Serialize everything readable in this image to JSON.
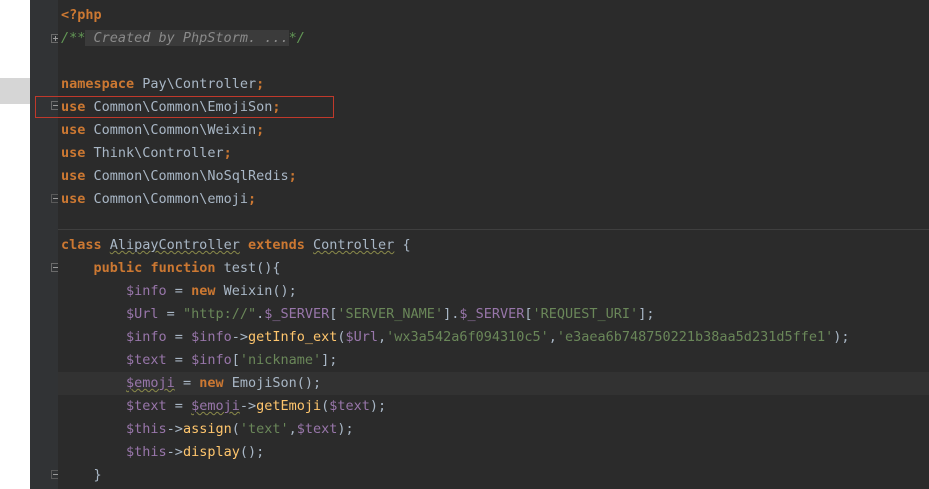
{
  "php_open": "<?php",
  "comment": {
    "open": "/**",
    "inner": " Created by PhpStorm. ...",
    "close": "*/"
  },
  "namespace": {
    "kw": "namespace",
    "name": "Pay\\Controller",
    "semi": ";"
  },
  "uses": [
    {
      "kw": "use",
      "name": "Common\\Common\\EmojiSon",
      "semi": ";"
    },
    {
      "kw": "use",
      "name": "Common\\Common\\Weixin",
      "semi": ";"
    },
    {
      "kw": "use",
      "name": "Think\\Controller",
      "semi": ";"
    },
    {
      "kw": "use",
      "name": "Common\\Common\\NoSqlRedis",
      "semi": ";"
    },
    {
      "kw": "use",
      "name": "Common\\Common\\emoji",
      "semi": ";"
    }
  ],
  "class_decl": {
    "kw": "class",
    "name": "AlipayController",
    "extends_kw": "extends",
    "parent": "Controller",
    "brace": "{"
  },
  "method_decl": {
    "kw1": "public",
    "kw2": "function",
    "name": "test",
    "rest": "(){"
  },
  "body": {
    "l1": {
      "var": "$info",
      "eq": " = ",
      "kw": "new",
      "cls": " Weixin",
      "end": "();"
    },
    "l2": {
      "var": "$Url",
      "eq": " = ",
      "str1": "\"http://\"",
      "dot1": ".",
      "var2": "$_SERVER",
      "b1": "[",
      "str2": "'SERVER_NAME'",
      "b2": "].",
      "var3": "$_SERVER",
      "b3": "[",
      "str3": "'REQUEST_URI'",
      "b4": "];"
    },
    "l3": {
      "var": "$info",
      "eq": " = ",
      "var2": "$info",
      "arrow": "->",
      "fn": "getInfo_ext",
      "p1": "(",
      "var3": "$Url",
      "c1": ",",
      "str1": "'wx3a542a6f094310c5'",
      "c2": ",",
      "str2": "'e3aea6b748750221b38aa5d231d5ffe1'",
      "end": ");"
    },
    "l4": {
      "var": "$text",
      "eq": " = ",
      "var2": "$info",
      "b1": "[",
      "str": "'nickname'",
      "b2": "];"
    },
    "l5": {
      "var": "$emoji",
      "eq": " = ",
      "kw": "new",
      "cls": " EmojiSon",
      "end": "();"
    },
    "l6": {
      "var": "$text",
      "eq": " = ",
      "var2": "$emoji",
      "arrow": "->",
      "fn": "getEmoji",
      "p1": "(",
      "var3": "$text",
      "end": ");"
    },
    "l7": {
      "var": "$this",
      "arrow": "->",
      "fn": "assign",
      "p1": "(",
      "str": "'text'",
      "c1": ",",
      "var2": "$text",
      "end": ");"
    },
    "l8": {
      "var": "$this",
      "arrow": "->",
      "fn": "display",
      "end": "();"
    }
  },
  "closing_brace": "}"
}
